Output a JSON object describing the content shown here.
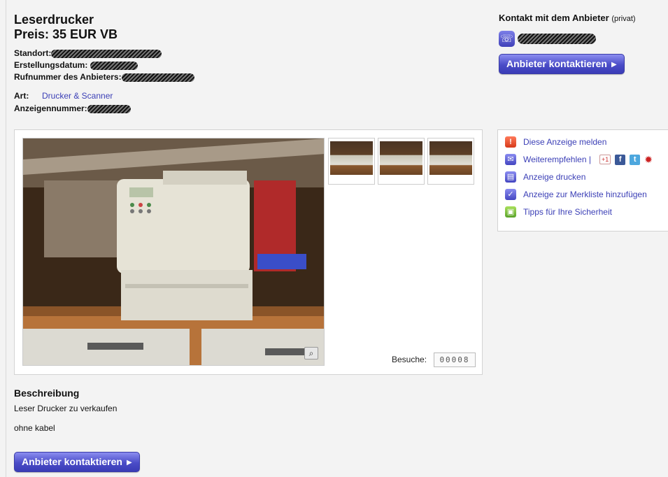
{
  "listing": {
    "title": "Leserdrucker",
    "price": "Preis: 35 EUR VB",
    "location_label": "Standort:",
    "created_label": "Erstellungsdatum:",
    "phone_label": "Rufnummer des Anbieters:",
    "category_label": "Art:",
    "category_value": "Drucker & Scanner",
    "ad_number_label": "Anzeigennummer:"
  },
  "contact": {
    "title": "Kontakt mit dem Anbieter",
    "subtitle": "(privat)",
    "button_label": "Anbieter kontaktieren",
    "icon": "phone-icon"
  },
  "gallery": {
    "visits_label": "Besuche:",
    "visits_value": "00008",
    "zoom_icon": "zoom-icon"
  },
  "actions": {
    "items": [
      {
        "label": "Diese Anzeige melden",
        "icon": "alert-icon"
      },
      {
        "label": "Weiterempfehlen |",
        "icon": "mail-icon"
      },
      {
        "label": "Anzeige drucken",
        "icon": "printer-icon"
      },
      {
        "label": "Anzeige zur Merkliste hinzufügen",
        "icon": "checkmark-icon"
      },
      {
        "label": "Tipps für Ihre Sicherheit",
        "icon": "lock-icon"
      }
    ],
    "share": {
      "gplus": "+1",
      "facebook": "f",
      "twitter": "t",
      "more": "✹"
    }
  },
  "description": {
    "title": "Beschreibung",
    "lines": [
      "Leser Drucker zu verkaufen",
      "ohne kabel"
    ]
  },
  "colors": {
    "link": "#3b3fb6",
    "button": "#4a4cc7",
    "background": "#f3f3f3"
  }
}
